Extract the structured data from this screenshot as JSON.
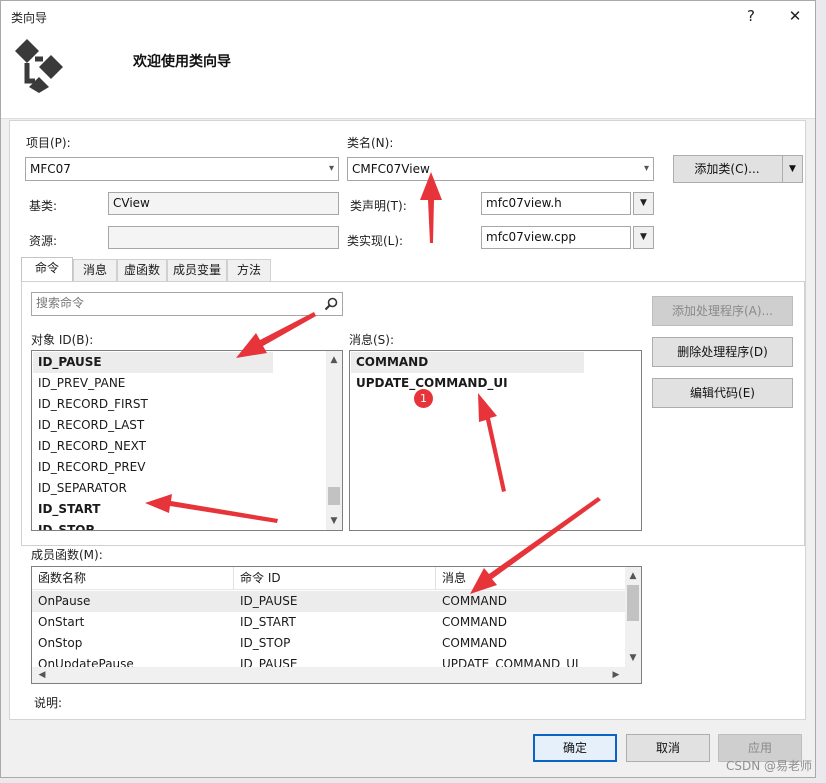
{
  "window": {
    "title": "类向导",
    "help_label": "?",
    "close_label": "✕"
  },
  "banner": {
    "heading": "欢迎使用类向导",
    "logo_icon": "class-wizard-logo-icon"
  },
  "fields": {
    "project_label": "项目(P):",
    "project_value": "MFC07",
    "classname_label": "类名(N):",
    "classname_value": "CMFC07View",
    "add_class_label": "添加类(C)...",
    "base_label": "基类:",
    "base_value": "CView",
    "resource_label": "资源:",
    "resource_value": "",
    "decl_label": "类声明(T):",
    "decl_value": "mfc07view.h",
    "impl_label": "类实现(L):",
    "impl_value": "mfc07view.cpp"
  },
  "tabs": [
    {
      "label": "命令"
    },
    {
      "label": "消息"
    },
    {
      "label": "虚函数"
    },
    {
      "label": "成员变量"
    },
    {
      "label": "方法"
    }
  ],
  "command_tab": {
    "search_placeholder": "搜索命令",
    "object_id_label": "对象 ID(B):",
    "object_ids": [
      {
        "text": "ID_PAUSE",
        "bold": true
      },
      {
        "text": "ID_PREV_PANE",
        "bold": false
      },
      {
        "text": "ID_RECORD_FIRST",
        "bold": false
      },
      {
        "text": "ID_RECORD_LAST",
        "bold": false
      },
      {
        "text": "ID_RECORD_NEXT",
        "bold": false
      },
      {
        "text": "ID_RECORD_PREV",
        "bold": false
      },
      {
        "text": "ID_SEPARATOR",
        "bold": false
      },
      {
        "text": "ID_START",
        "bold": true
      },
      {
        "text": "ID_STOP",
        "bold": true
      }
    ],
    "messages_label": "消息(S):",
    "messages": [
      {
        "text": "COMMAND"
      },
      {
        "text": "UPDATE_COMMAND_UI"
      }
    ],
    "add_handler_label": "添加处理程序(A)...",
    "delete_handler_label": "删除处理程序(D)",
    "edit_code_label": "编辑代码(E)"
  },
  "members": {
    "label": "成员函数(M):",
    "columns": [
      "函数名称",
      "命令 ID",
      "消息"
    ],
    "rows": [
      [
        "OnPause",
        "ID_PAUSE",
        "COMMAND"
      ],
      [
        "OnStart",
        "ID_START",
        "COMMAND"
      ],
      [
        "OnStop",
        "ID_STOP",
        "COMMAND"
      ],
      [
        "OnUpdatePause",
        "ID_PAUSE",
        "UPDATE_COMMAND_UI"
      ]
    ]
  },
  "description_label": "说明:",
  "footer": {
    "ok_label": "确定",
    "cancel_label": "取消",
    "apply_label": "应用"
  },
  "annotation_badge": "1",
  "watermark": "CSDN @易老师",
  "colors": {
    "annotation_red": "#e6343a",
    "focus_blue": "#0a63c6"
  }
}
